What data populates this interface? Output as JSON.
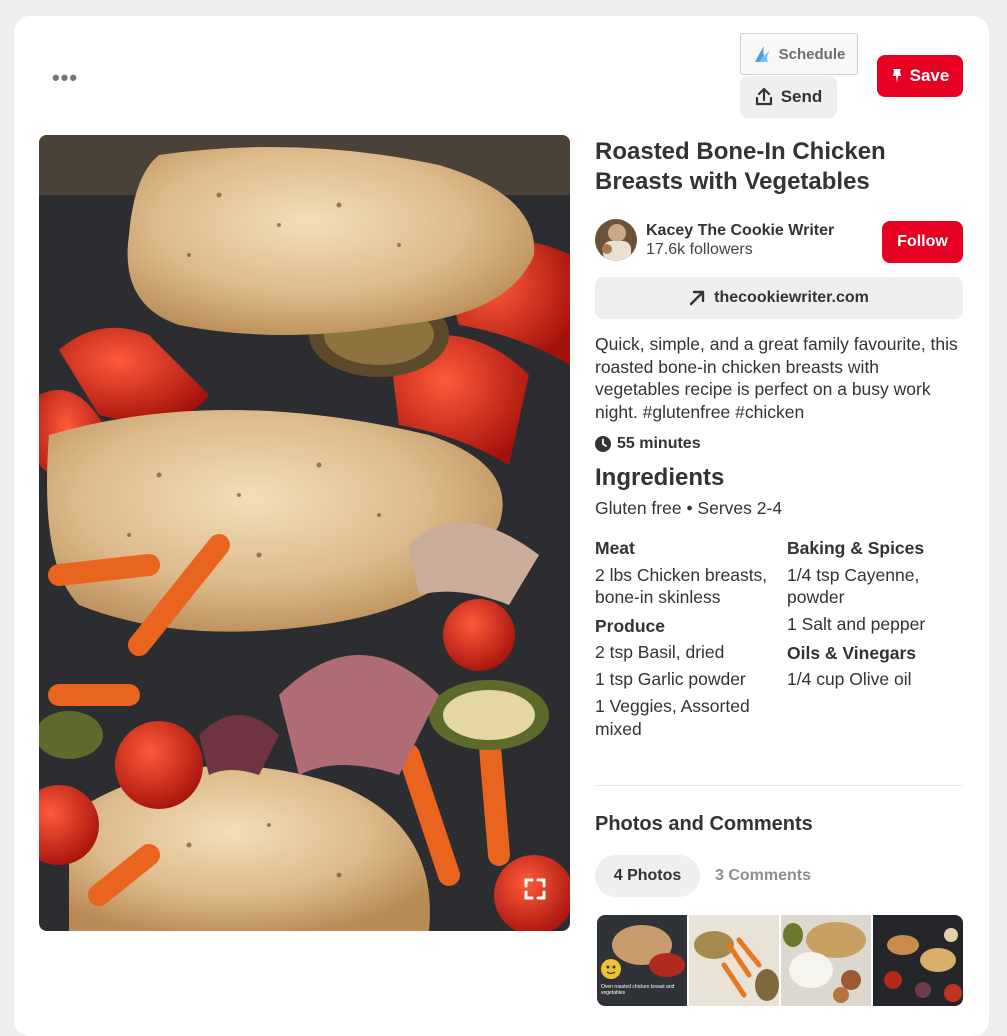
{
  "toolbar": {
    "more_label": "•••",
    "schedule_label": "Schedule",
    "send_label": "Send",
    "save_label": "Save"
  },
  "pin": {
    "title": "Roasted Bone-In Chicken Breasts with Vegetables",
    "author_name": "Kacey The Cookie Writer",
    "author_followers": "17.6k followers",
    "follow_label": "Follow",
    "source_link": "thecookiewriter.com",
    "description": "Quick, simple, and a great family favourite, this roasted bone-in chicken breasts with vegetables recipe is perfect on a busy work night. #glutenfree #chicken",
    "cook_time": "55 minutes"
  },
  "ingredients": {
    "title": "Ingredients",
    "subtitle": "Gluten free • Serves 2-4",
    "left_groups": [
      {
        "name": "Meat",
        "items": [
          "2 lbs Chicken breasts, bone-in skinless"
        ]
      },
      {
        "name": "Produce",
        "items": [
          "2 tsp Basil, dried",
          "1 tsp Garlic powder",
          "1 Veggies, Assorted mixed"
        ]
      }
    ],
    "right_groups": [
      {
        "name": "Baking & Spices",
        "items": [
          "1/4 tsp Cayenne, powder",
          "1 Salt and pepper"
        ]
      },
      {
        "name": "Oils & Vinegars",
        "items": [
          "1/4 cup Olive oil"
        ]
      }
    ]
  },
  "photos_comments": {
    "title": "Photos and Comments",
    "tab_photos": "4 Photos",
    "tab_comments": "3 Comments",
    "thumb_caption": "Oven roasted chicken breast and vegetables"
  },
  "colors": {
    "brand_red": "#e60023",
    "pill_gray": "#efefef",
    "text_dark": "#333333"
  },
  "icons": [
    "more-icon",
    "schedule-logo-icon",
    "send-share-icon",
    "pushpin-icon",
    "expand-icon",
    "arrow-up-right-icon",
    "clock-icon"
  ]
}
